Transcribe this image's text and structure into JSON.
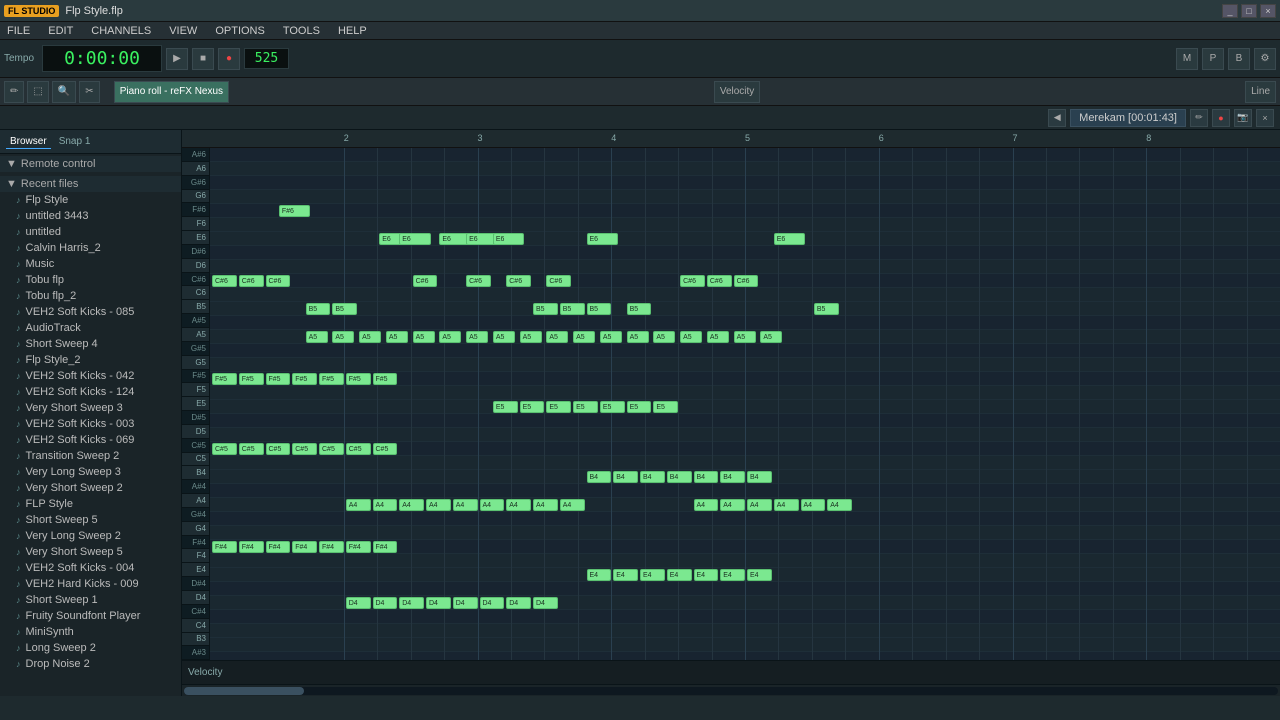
{
  "titleBar": {
    "logo": "FL STUDIO",
    "title": "Flp Style.flp",
    "controls": [
      "_",
      "□",
      "×"
    ]
  },
  "menuBar": {
    "items": [
      "FILE",
      "EDIT",
      "CHANNELS",
      "VIEW",
      "OPTIONS",
      "TOOLS",
      "HELP"
    ]
  },
  "transport": {
    "time": "0:00:00",
    "bpm": "525",
    "bpmLabel": "525",
    "playBtn": "▶",
    "stopBtn": "■",
    "recBtn": "●",
    "tempoLabel": "Tempo"
  },
  "pianoRoll": {
    "title": "Piano roll - reFX Nexus",
    "velocityLabel": "Velocity",
    "lineLabel": "Line"
  },
  "merekam": {
    "label": "Merekam [00:01:43]"
  },
  "sidebar": {
    "tabs": [
      "Browser",
      "Snap 1"
    ],
    "sections": [
      {
        "header": "Remote control",
        "items": []
      },
      {
        "header": "Recent files",
        "items": [
          "Flp Style",
          "untitled 3443",
          "untitled",
          "Calvin Harris_2",
          "Music",
          "Tobu flp",
          "Tobu flp_2",
          "VEH2 Soft Kicks - 085",
          "AudioTrack",
          "Short Sweep 4",
          "Flp Style_2",
          "VEH2 Soft Kicks - 042",
          "VEH2 Soft Kicks - 124",
          "Very Short Sweep 3",
          "VEH2 Soft Kicks - 003",
          "VEH2 Soft Kicks - 069",
          "Transition Sweep 2",
          "Very Long Sweep 3",
          "Very Short Sweep 2",
          "FLP Style",
          "Short Sweep 5",
          "Very Long Sweep 2",
          "Very Short Sweep 5",
          "VEH2 Soft Kicks - 004",
          "VEH2 Hard Kicks - 009",
          "Short Sweep 1",
          "Fruity Soundfont Player",
          "MiniSynth",
          "Long Sweep 2",
          "Drop Noise 2"
        ]
      }
    ]
  },
  "pianoKeys": [
    {
      "note": "A#6",
      "type": "black"
    },
    {
      "note": "A6",
      "type": "white"
    },
    {
      "note": "G#6",
      "type": "black"
    },
    {
      "note": "G6",
      "type": "white"
    },
    {
      "note": "F#6",
      "type": "black"
    },
    {
      "note": "F6",
      "type": "white"
    },
    {
      "note": "E6",
      "type": "white"
    },
    {
      "note": "D#6",
      "type": "black"
    },
    {
      "note": "D6",
      "type": "white"
    },
    {
      "note": "C#6",
      "type": "black"
    },
    {
      "note": "C6",
      "type": "white"
    },
    {
      "note": "B5",
      "type": "white"
    },
    {
      "note": "A#5",
      "type": "black"
    },
    {
      "note": "A5",
      "type": "white"
    },
    {
      "note": "G#5",
      "type": "black"
    },
    {
      "note": "G5",
      "type": "white"
    },
    {
      "note": "F#5",
      "type": "black"
    },
    {
      "note": "F5",
      "type": "white"
    },
    {
      "note": "E5",
      "type": "white"
    },
    {
      "note": "D#5",
      "type": "black"
    },
    {
      "note": "D5",
      "type": "white"
    },
    {
      "note": "C#5",
      "type": "black"
    },
    {
      "note": "C5",
      "type": "white"
    },
    {
      "note": "B4",
      "type": "white"
    },
    {
      "note": "A#4",
      "type": "black"
    },
    {
      "note": "A4",
      "type": "white"
    },
    {
      "note": "G#4",
      "type": "black"
    },
    {
      "note": "G4",
      "type": "white"
    },
    {
      "note": "F#4",
      "type": "black"
    },
    {
      "note": "F4",
      "type": "white"
    },
    {
      "note": "E4",
      "type": "white"
    },
    {
      "note": "D#4",
      "type": "black"
    },
    {
      "note": "D4",
      "type": "white"
    },
    {
      "note": "C#4",
      "type": "black"
    },
    {
      "note": "C4",
      "type": "white"
    },
    {
      "note": "B3",
      "type": "white"
    },
    {
      "note": "A#3",
      "type": "black"
    }
  ],
  "beatMarkers": [
    "2",
    "3",
    "4",
    "5",
    "6",
    "7",
    "8"
  ],
  "velocityBarLabel": "Velocity"
}
